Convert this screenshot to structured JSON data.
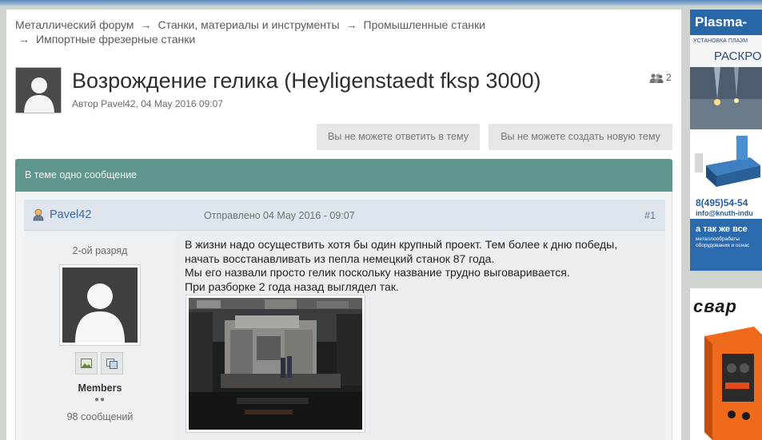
{
  "breadcrumb": {
    "items": [
      "Металлический форум",
      "Станки, материалы и инструменты",
      "Промышленные станки",
      "Импортные фрезерные станки"
    ],
    "separator": "→"
  },
  "topic": {
    "title": "Возрождение гелика (Heyligenstaedt fksp 3000)",
    "author_line": "Автор Pavel42, 04 May 2016 09:07",
    "viewers_count": "2"
  },
  "buttons": {
    "reply": "Вы не можете ответить в тему",
    "new_topic": "Вы не можете создать новую тему"
  },
  "topic_bar": "В теме одно сообщение",
  "post": {
    "username": "Pavel42",
    "date": "Отправлено 04 May 2016 - 09:07",
    "number": "#1",
    "rank": "2-ой разряд",
    "group": "Members",
    "pips": "●●",
    "post_count": "98 сообщений",
    "lines": [
      "В жизни надо осуществить хотя бы один крупный проект. Тем более к дню победы,",
      "начать восстанавливать из пепла немецкий станок 87 года.",
      "Мы его назвали просто гелик поскольку название трудно выговаривается.",
      "При разборке 2 года назад выглядел так."
    ]
  },
  "ads": {
    "ad1_head": "Plasma-",
    "ad1_sub": "УСТАНОВКА ПЛАЗМ",
    "ad1_big": "РАСКРО",
    "ad1_phone": "8(495)54-54",
    "ad1_mail": "info@knuth-indu",
    "ad1_bot1": "а так же все",
    "ad1_bot2a": "металлообрабаты",
    "ad1_bot2b": "оборудования и оснас",
    "ad2_text": "свар"
  },
  "colors": {
    "topic_bar": "#5f968d",
    "post_header": "#dfe5ec",
    "link_blue": "#3c6aa3"
  }
}
